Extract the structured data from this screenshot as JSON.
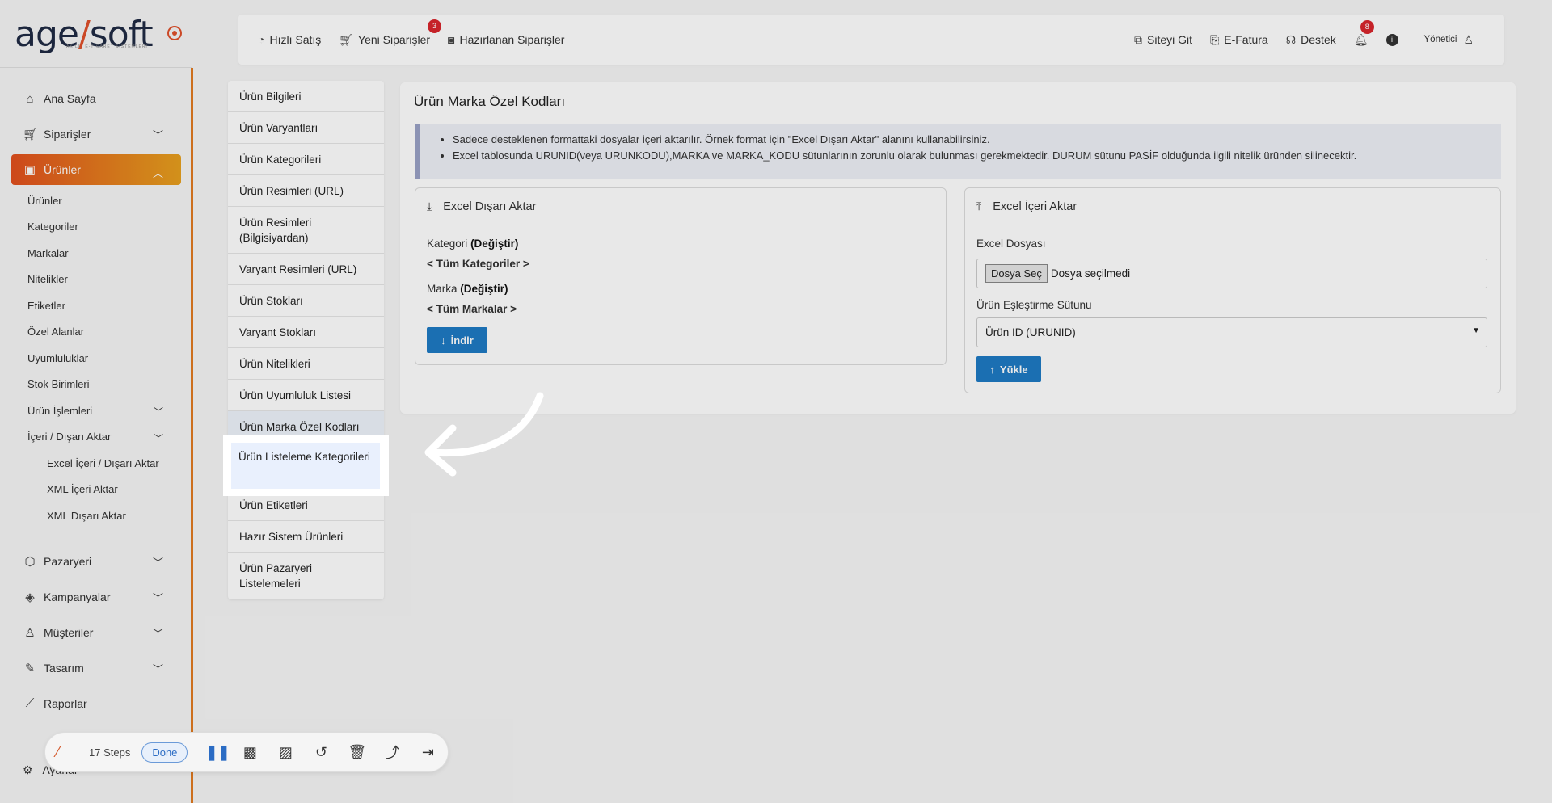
{
  "logo": {
    "text_a": "age",
    "text_b": "soft",
    "sub": "AKILLI E-TİCARET SİSTEMLERİ"
  },
  "sidebar": {
    "items": [
      {
        "label": "Ana Sayfa",
        "icon": "home-icon"
      },
      {
        "label": "Siparişler",
        "icon": "cart-icon"
      },
      {
        "label": "Ürünler",
        "icon": "book-icon"
      }
    ],
    "sub_items": [
      {
        "label": "Ürünler"
      },
      {
        "label": "Kategoriler"
      },
      {
        "label": "Markalar"
      },
      {
        "label": "Nitelikler"
      },
      {
        "label": "Etiketler"
      },
      {
        "label": "Özel Alanlar"
      },
      {
        "label": "Uyumluluklar"
      },
      {
        "label": "Stok Birimleri"
      },
      {
        "label": "Ürün İşlemleri"
      },
      {
        "label": "İçeri / Dışarı Aktar"
      }
    ],
    "sub2_items": [
      {
        "label": "Excel İçeri / Dışarı Aktar"
      },
      {
        "label": "XML İçeri Aktar"
      },
      {
        "label": "XML Dışarı Aktar"
      }
    ],
    "items_bottom": [
      {
        "label": "Pazaryeri",
        "icon": "box-icon"
      },
      {
        "label": "Kampanyalar",
        "icon": "tag-icon"
      },
      {
        "label": "Müşteriler",
        "icon": "user-icon"
      },
      {
        "label": "Tasarım",
        "icon": "palette-icon"
      },
      {
        "label": "Raporlar",
        "icon": "chart-icon"
      }
    ],
    "partial_label": "Ayarlar"
  },
  "topbar": {
    "quick_sale": "Hızlı Satış",
    "new_orders": "Yeni Siparişler",
    "new_orders_badge": "3",
    "preparing_orders": "Hazırlanan Siparişler",
    "go_site": "Siteyi Git",
    "einvoice": "E-Fatura",
    "support": "Destek",
    "notif_badge": "8",
    "user": "Yönetici"
  },
  "submenu": [
    "Ürün Bilgileri",
    "Ürün Varyantları",
    "Ürün Kategorileri",
    "Ürün Resimleri (URL)",
    "Ürün Resimleri (Bilgisiyardan)",
    "Varyant Resimleri (URL)",
    "Ürün Stokları",
    "Varyant Stokları",
    "Ürün Nitelikleri",
    "Ürün Uyumluluk Listesi",
    "Ürün Marka Özel Kodları",
    "Ürün Listeleme Kategorileri",
    "Ürün Etiketleri",
    "Hazır Sistem Ürünleri",
    "Ürün Pazaryeri Listelemeleri"
  ],
  "main": {
    "title": "Ürün Marka Özel Kodları",
    "info": [
      "Sadece desteklenen formattaki dosyalar içeri aktarılır. Örnek format için \"Excel Dışarı Aktar\" alanını kullanabilirsiniz.",
      "Excel tablosunda URUNID(veya URUNKODU),MARKA ve MARKA_KODU sütunlarının zorunlu olarak bulunması gerekmektedir. DURUM sütunu PASİF olduğunda ilgili nitelik üründen silinecektir."
    ],
    "export": {
      "title": "Excel Dışarı Aktar",
      "category_label": "Kategori",
      "change": "(Değiştir)",
      "all_categories": "< Tüm Kategoriler >",
      "brand_label": "Marka",
      "all_brands": "< Tüm Markalar >",
      "download": "İndir"
    },
    "import": {
      "title": "Excel İçeri Aktar",
      "file_label": "Excel Dosyası",
      "file_button": "Dosya Seç",
      "file_none": "Dosya seçilmedi",
      "match_label": "Ürün Eşleştirme Sütunu",
      "match_value": "Ürün ID (URUNID)",
      "upload": "Yükle"
    }
  },
  "recorder": {
    "steps": "17 Steps",
    "done": "Done"
  }
}
